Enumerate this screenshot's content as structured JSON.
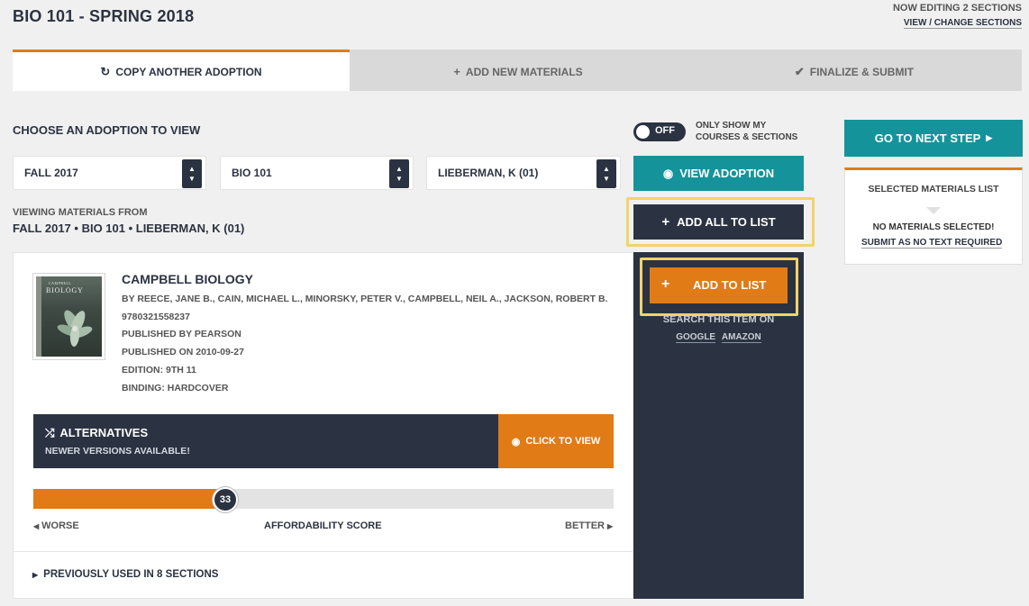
{
  "header": {
    "title": "BIO 101 - SPRING 2018",
    "editing": "NOW EDITING 2 SECTIONS",
    "view_change": "VIEW / CHANGE SECTIONS"
  },
  "tabs": [
    {
      "label": "COPY ANOTHER ADOPTION",
      "icon": "refresh-icon",
      "glyph": "↻",
      "active": true
    },
    {
      "label": "ADD NEW MATERIALS",
      "icon": "plus-icon",
      "glyph": "+",
      "active": false
    },
    {
      "label": "FINALIZE & SUBMIT",
      "icon": "check-icon",
      "glyph": "✔",
      "active": false
    }
  ],
  "choose": {
    "title": "CHOOSE AN ADOPTION TO VIEW",
    "toggle_state": "OFF",
    "toggle_text": "ONLY SHOW MY COURSES & SECTIONS",
    "term": "FALL 2017",
    "course": "BIO 101",
    "instructor": "LIEBERMAN, K (01)",
    "view_button": "VIEW ADOPTION"
  },
  "viewing": {
    "label": "VIEWING MATERIALS FROM",
    "value": "FALL 2017 • BIO 101 • LIEBERMAN, K (01)"
  },
  "actions": {
    "add_all": "ADD ALL TO LIST",
    "add_to_list": "ADD TO LIST",
    "search_on": "SEARCH THIS ITEM ON",
    "google": "GOOGLE",
    "amazon": "AMAZON"
  },
  "book": {
    "title": "CAMPBELL BIOLOGY",
    "authors": "BY REECE, JANE B., CAIN, MICHAEL L., MINORSKY, PETER V., CAMPBELL, NEIL A., JACKSON, ROBERT B.",
    "isbn": "9780321558237",
    "publisher": "PUBLISHED BY PEARSON",
    "published_on": "PUBLISHED ON 2010-09-27",
    "edition": "EDITION: 9TH 11",
    "binding": "BINDING: HARDCOVER",
    "cover_small": "CAMPBELL",
    "cover_large": "BIOLOGY"
  },
  "alternatives": {
    "title": "ALTERNATIVES",
    "subtitle": "NEWER VERSIONS AVAILABLE!",
    "button": "CLICK TO VIEW"
  },
  "affordability": {
    "score": 33,
    "max": 100,
    "worse": "WORSE",
    "label": "AFFORDABILITY SCORE",
    "better": "BETTER"
  },
  "previously_used": "PREVIOUSLY USED IN 8 SECTIONS",
  "sidebar": {
    "next_step": "GO TO NEXT STEP",
    "selected_title": "SELECTED MATERIALS LIST",
    "no_materials": "NO MATERIALS SELECTED!",
    "submit_no_text": "SUBMIT AS NO TEXT REQUIRED"
  },
  "colors": {
    "accent_orange": "#e07b16",
    "teal": "#14939b",
    "navy": "#2b3342",
    "highlight": "#f3d36a"
  }
}
